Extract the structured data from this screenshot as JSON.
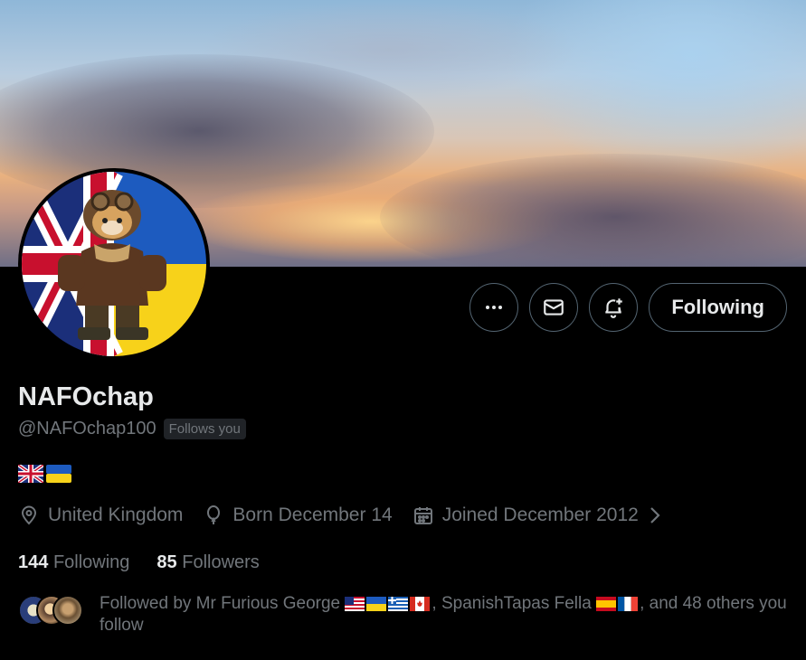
{
  "profile": {
    "name": "NAFOchap",
    "handle": "@NAFOchap100",
    "follows_you": "Follows you",
    "bio_flags": [
      "uk-flag-icon",
      "ukraine-flag-icon"
    ],
    "location": "United Kingdom",
    "birthday": "Born December 14",
    "joined": "Joined December 2012",
    "following_count": "144",
    "following_label": "Following",
    "followers_count": "85",
    "followers_label": "Followers"
  },
  "actions": {
    "more_icon": "more-horizontal-icon",
    "message_icon": "envelope-icon",
    "notify_icon": "bell-plus-icon",
    "follow_label": "Following"
  },
  "followed_by": {
    "prefix": "Followed by ",
    "user1": "Mr Furious George",
    "user1_flags": [
      "usa-flag-icon",
      "ukraine-flag-icon",
      "greece-flag-icon",
      "canada-flag-icon"
    ],
    "sep1": ", ",
    "user2": "SpanishTapas Fella",
    "user2_flags": [
      "spain-flag-icon",
      "france-flag-icon"
    ],
    "suffix": ", and 48 others you follow"
  },
  "colors": {
    "background": "#000000",
    "text_primary": "#e7e9ea",
    "text_secondary": "#71767b",
    "border": "#536471"
  }
}
